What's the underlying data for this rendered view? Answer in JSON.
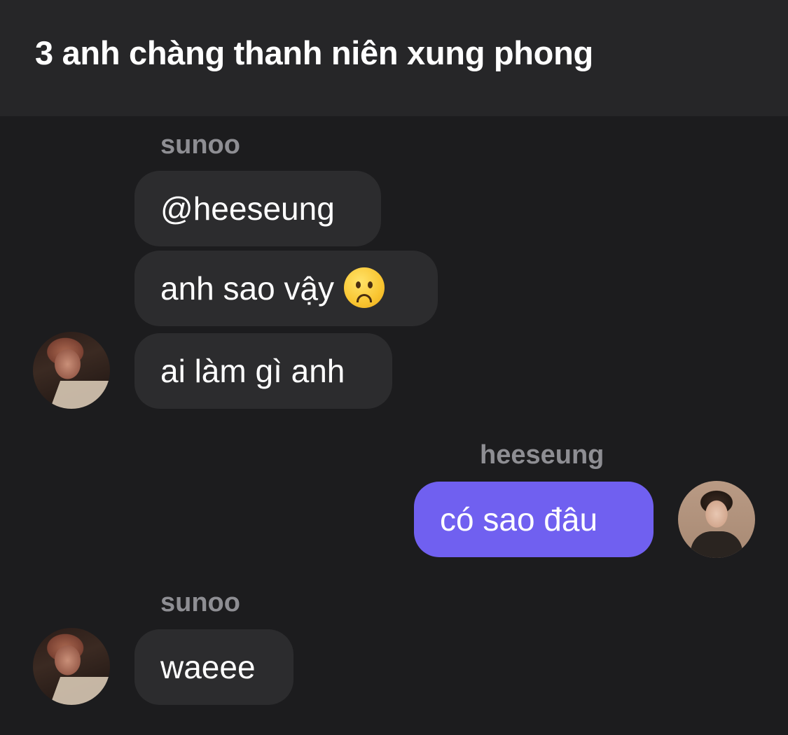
{
  "header": {
    "title": "3 anh chàng thanh niên xung phong"
  },
  "messages": {
    "group1": {
      "sender": "sunoo",
      "bubbles": [
        "@heeseung",
        "anh sao vậy",
        "ai làm gì anh"
      ],
      "emoji": "frowning-face-icon"
    },
    "group2": {
      "sender": "heeseung",
      "bubbles": [
        "có sao đâu"
      ]
    },
    "group3": {
      "sender": "sunoo",
      "bubbles": [
        "waeee"
      ]
    }
  },
  "colors": {
    "background": "#1c1c1e",
    "header_background": "#262628",
    "incoming_bubble": "#2c2c2e",
    "outgoing_bubble": "#7060f0",
    "sender_name": "#8e8e93"
  }
}
